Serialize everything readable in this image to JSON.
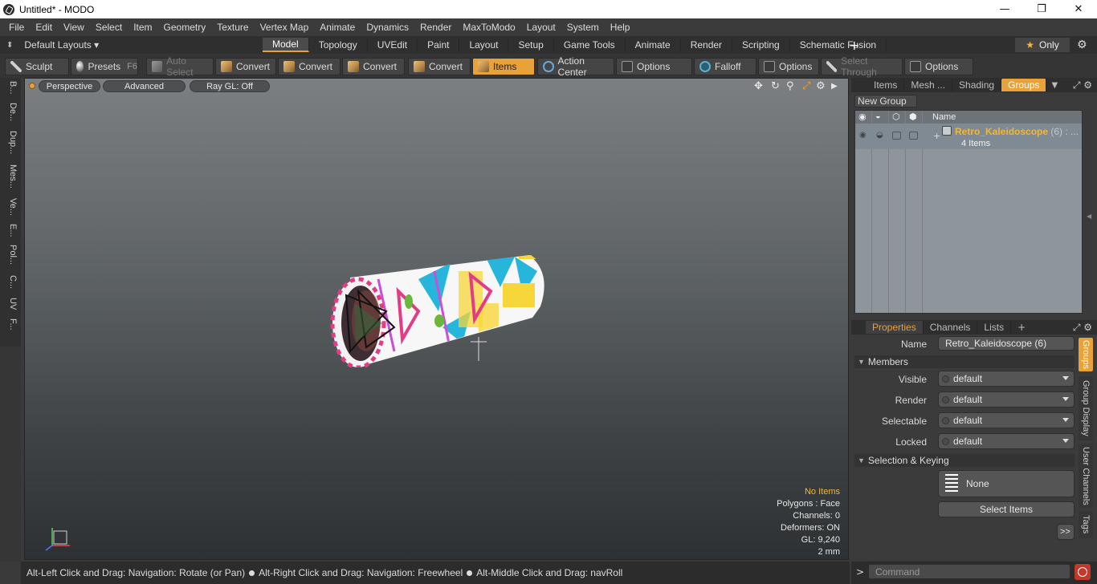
{
  "window": {
    "title": "Untitled* - MODO",
    "minimize": "—",
    "maximize": "❐",
    "close": "✕"
  },
  "menu": [
    "File",
    "Edit",
    "View",
    "Select",
    "Item",
    "Geometry",
    "Texture",
    "Vertex Map",
    "Animate",
    "Dynamics",
    "Render",
    "MaxToModo",
    "Layout",
    "System",
    "Help"
  ],
  "layout_bar": {
    "layouts_label": "Default Layouts ▾",
    "tabs": [
      "Model",
      "Topology",
      "UVEdit",
      "Paint",
      "Layout",
      "Setup",
      "Game Tools",
      "Animate",
      "Render",
      "Scripting",
      "Schematic Fusion"
    ],
    "active_tab": "Model",
    "only_label": "Only"
  },
  "toolbar": {
    "sculpt": "Sculpt",
    "presets": "Presets",
    "presets_key": "F6",
    "auto_select": "Auto Select",
    "convert1": "Convert",
    "convert2": "Convert",
    "convert3": "Convert",
    "convert4": "Convert",
    "items": "Items",
    "action_center": "Action Center",
    "options1": "Options",
    "falloff": "Falloff",
    "options2": "Options",
    "select_through": "Select Through",
    "options3": "Options"
  },
  "left_tabs": [
    "B...",
    "De...",
    "Dup...",
    "Mes...",
    "Ve...",
    "E...",
    "Pol...",
    "C...",
    "UV",
    "F..."
  ],
  "viewport": {
    "perspective": "Perspective",
    "advanced": "Advanced",
    "raygl": "Ray GL: Off",
    "stats": {
      "no_items": "No Items",
      "polygons": "Polygons : Face",
      "channels": "Channels: 0",
      "deformers": "Deformers: ON",
      "gl": "GL: 9,240",
      "unit": "2 mm"
    }
  },
  "groups_panel": {
    "tabs": [
      "Items",
      "Mesh ...",
      "Shading",
      "Groups"
    ],
    "active_tab": "Groups",
    "new_group": "New Group",
    "col_name": "Name",
    "group_name": "Retro_Kaleidoscope",
    "group_suffix": "(6) : ...",
    "group_items": "4 Items"
  },
  "properties": {
    "tabs": [
      "Properties",
      "Channels",
      "Lists"
    ],
    "name_label": "Name",
    "name_value": "Retro_Kaleidoscope (6)",
    "members_section": "Members",
    "visible_label": "Visible",
    "visible_value": "default",
    "render_label": "Render",
    "render_value": "default",
    "selectable_label": "Selectable",
    "selectable_value": "default",
    "locked_label": "Locked",
    "locked_value": "default",
    "selection_section": "Selection & Keying",
    "none_btn": "None",
    "select_items_btn": "Select Items",
    "more_btn": ">>",
    "side_tabs": [
      "Groups",
      "Group Display",
      "User Channels",
      "Tags"
    ]
  },
  "statusbar": {
    "hint1": "Alt-Left Click and Drag: Navigation: Rotate (or Pan)",
    "hint2": "Alt-Right Click and Drag: Navigation: Freewheel",
    "hint3": "Alt-Middle Click and Drag: navRoll"
  },
  "command": {
    "prompt": ">",
    "placeholder": "Command"
  },
  "colors": {
    "accent": "#e8a237",
    "panel": "#3b3b3b",
    "viewport_top": "#7b7f82",
    "viewport_bottom": "#2e3133"
  }
}
